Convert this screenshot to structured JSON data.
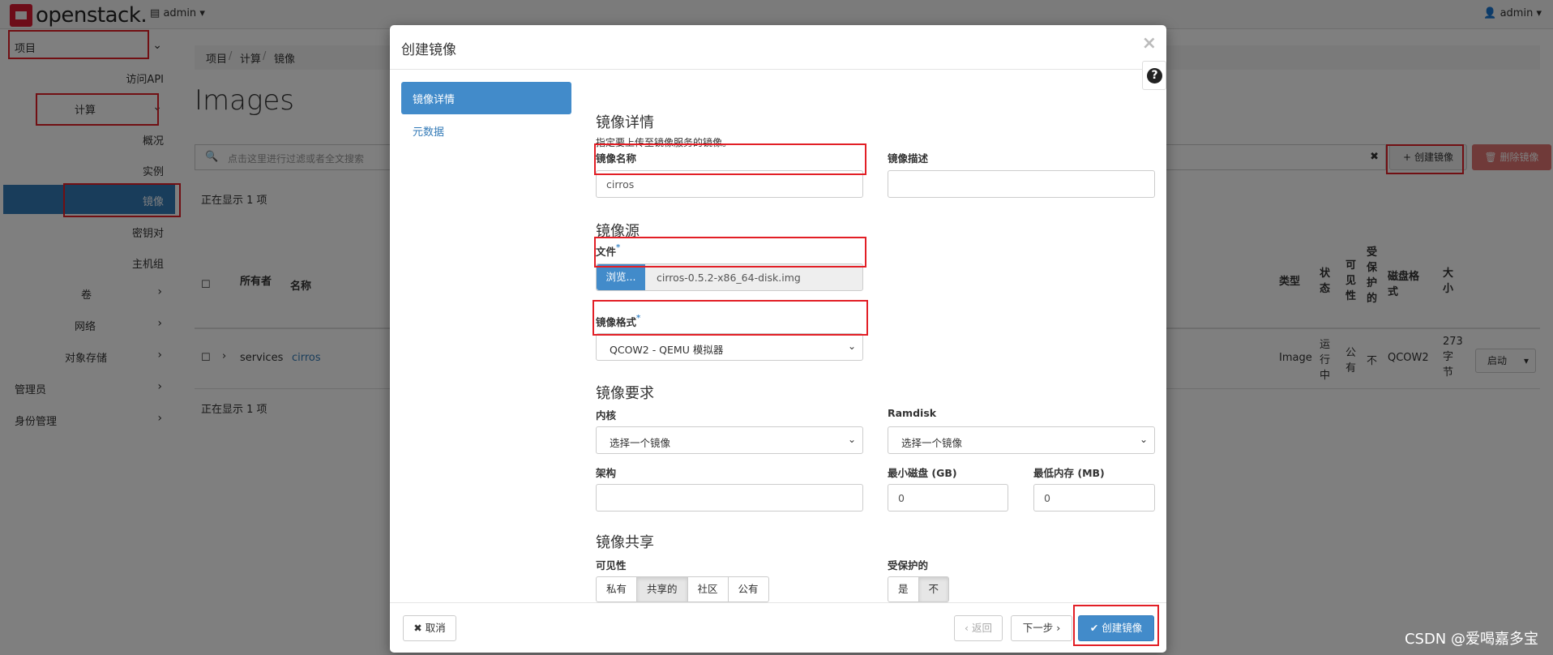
{
  "topbar": {
    "logo_text": "openstack.",
    "project_switcher": "admin",
    "user_menu": "admin"
  },
  "sidebar": {
    "project": "项目",
    "api_access": "访问API",
    "compute": "计算",
    "overview": "概况",
    "instances": "实例",
    "images": "镜像",
    "key_pairs": "密钥对",
    "server_groups": "主机组",
    "volumes": "卷",
    "network": "网络",
    "object_store": "对象存储",
    "admin": "管理员",
    "identity": "身份管理"
  },
  "main": {
    "breadcrumb": [
      "项目",
      "计算",
      "镜像"
    ],
    "title": "Images",
    "filter_placeholder": "点击这里进行过滤或者全文搜索",
    "create_button": "创建镜像",
    "delete_button": "删除镜像",
    "count_text": "正在显示 1 项",
    "columns": {
      "owner": "所有者",
      "name": "名称",
      "type": "类型",
      "status": "状态",
      "visibility": "可见性",
      "protected": "受保护的",
      "disk_format": "磁盘格式",
      "size": "大小"
    },
    "row": {
      "owner": "services",
      "name": "cirros",
      "type": "Image",
      "status": "运行中",
      "visibility": "公有",
      "protected": "不",
      "disk_format": "QCOW2",
      "size": "273字节",
      "action": "启动"
    }
  },
  "modal": {
    "title": "创建镜像",
    "steps": [
      "镜像详情",
      "元数据"
    ],
    "details": {
      "section_title": "镜像详情",
      "help": "指定要上传至镜像服务的镜像。",
      "name_label": "镜像名称",
      "name_value": "cirros",
      "desc_label": "镜像描述",
      "desc_value": ""
    },
    "source": {
      "section_title": "镜像源",
      "file_label": "文件",
      "browse": "浏览...",
      "file_name": "cirros-0.5.2-x86_64-disk.img",
      "format_label": "镜像格式",
      "format_value": "QCOW2 - QEMU 模拟器"
    },
    "requirements": {
      "section_title": "镜像要求",
      "kernel_label": "内核",
      "kernel_value": "选择一个镜像",
      "ramdisk_label": "Ramdisk",
      "ramdisk_value": "选择一个镜像",
      "arch_label": "架构",
      "arch_value": "",
      "min_disk_label": "最小磁盘 (GB)",
      "min_disk_value": "0",
      "min_ram_label": "最低内存 (MB)",
      "min_ram_value": "0"
    },
    "sharing": {
      "section_title": "镜像共享",
      "visibility_label": "可见性",
      "visibility_options": [
        "私有",
        "共享的",
        "社区",
        "公有"
      ],
      "visibility_selected": "共享的",
      "protected_label": "受保护的",
      "protected_options": [
        "是",
        "不"
      ],
      "protected_selected": "不"
    },
    "footer": {
      "cancel": "取消",
      "back": "返回",
      "next": "下一步",
      "create": "创建镜像"
    }
  },
  "watermark": "CSDN @爱喝嘉多宝",
  "colors": {
    "primary": "#428bca",
    "highlight_box": "#e21f26",
    "logo": "#da1a32"
  }
}
